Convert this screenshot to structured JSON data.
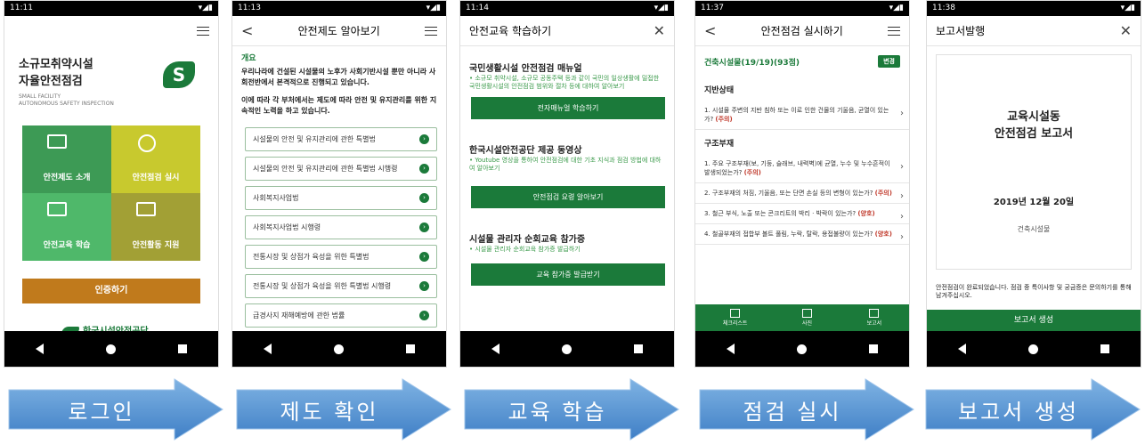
{
  "status_times": [
    "11:11",
    "11:13",
    "11:14",
    "11:37",
    "11:38"
  ],
  "status_right": "▾◢▮",
  "screen1": {
    "title_line1": "소규모취약시설",
    "title_line2": "자율안전점검",
    "subtitle_line1": "SMALL FACILITY",
    "subtitle_line2": "AUTONOMOUS SAFETY INSPECTION",
    "tiles": [
      {
        "label": "안전제도 소개",
        "color": "#3d9a55"
      },
      {
        "label": "안전점검 실시",
        "color": "#c8c92e"
      },
      {
        "label": "안전교육 학습",
        "color": "#4fb86a"
      },
      {
        "label": "안전활동 지원",
        "color": "#a2a035"
      }
    ],
    "login_label": "인증하기",
    "org_name": "한국시설안전공단"
  },
  "screen2": {
    "title": "안전제도 알아보기",
    "section": "개요",
    "para1": "우리나라에 건설된 시설물의 노후가 사회기반시설 뿐만 아니라 사회전반에서 본격적으로 진행되고 있습니다.",
    "para2": "이에 따라 각 부처에서는 제도에 따라 안전 및 유지관리를 위한 지속적인 노력을 하고 있습니다.",
    "items": [
      "시설물의 안전 및 유지관리에 관한 특별법",
      "시설물의 안전 및 유지관리에 관한 특별법 시행령",
      "사회복지사업법",
      "사회복지사업법 시행령",
      "전통시장 및 상점가 육성을 위한 특별법",
      "전통시장 및 상점가 육성을 위한 특별법 시행령",
      "급경사지 재해예방에 관한 법률"
    ]
  },
  "screen3": {
    "title": "안전교육 학습하기",
    "sections": [
      {
        "heading": "국민생활시설 안전점검 매뉴얼",
        "desc": "• 소규모 취약시설, 소규모 공동주택 등과 같이 국민의 일상생활에 밀접한 국민생활시설의 안전점검 범위와 절차 등에 대하여 알아보기",
        "button": "전자매뉴얼 학습하기"
      },
      {
        "heading": "한국시설안전공단 제공 동영상",
        "desc": "• Youtube 영상을 통하여 안전점검에 대한 기초 지식과 점검 방법에 대하여 알아보기",
        "button": "안전점검 요령 알아보기"
      },
      {
        "heading": "시설물 관리자 순회교육 참가증",
        "desc": "• 시설물 관리자 순회교육 참가증 발급하기",
        "button": "교육 참가증 발급받기"
      }
    ]
  },
  "screen4": {
    "title": "안전점검 실시하기",
    "facility": "건축시설물(19/19)(93점)",
    "change_label": "변경",
    "cat1": "지반상태",
    "cat1_items": [
      {
        "text": "1. 시설물 주변의 지반 침하 또는 이로 인한 건물의 기울음, 균열이 있는가?",
        "tag": "(주의)"
      }
    ],
    "cat2": "구조부재",
    "cat2_items": [
      {
        "text": "1. 주요 구조부재(보, 기둥, 슬래브, 내력벽)에 균열, 누수 및 누수흔적이 발생되었는가?",
        "tag": "(주의)"
      },
      {
        "text": "2. 구조부재의 처짐, 기울음, 또는 단면 손실 등의 변형이 있는가?",
        "tag": "(주의)"
      },
      {
        "text": "3. 철근 부식, 노출 또는 콘크리트의 박리 · 박락이 있는가?",
        "tag": "(양호)"
      },
      {
        "text": "4. 철골부재의 접합부 볼트 풀림, 누락, 탈락, 용접불량이 있는가?",
        "tag": "(양호)"
      }
    ],
    "tabs": [
      "체크리스트",
      "사진",
      "보고서"
    ]
  },
  "screen5": {
    "title": "보고서발행",
    "report_line1": "교육시설동",
    "report_line2": "안전점검 보고서",
    "date": "2019년 12월 20일",
    "category": "건축시설물",
    "message": "안전점검이 완료되었습니다. 점검 중 특이사항 및 궁금증은 문의하기를 통해 남겨주십시오.",
    "generate_label": "보고서 생성"
  },
  "arrows": [
    "로그인",
    "제도 확인",
    "교육 학습",
    "점검 실시",
    "보고서 생성"
  ]
}
